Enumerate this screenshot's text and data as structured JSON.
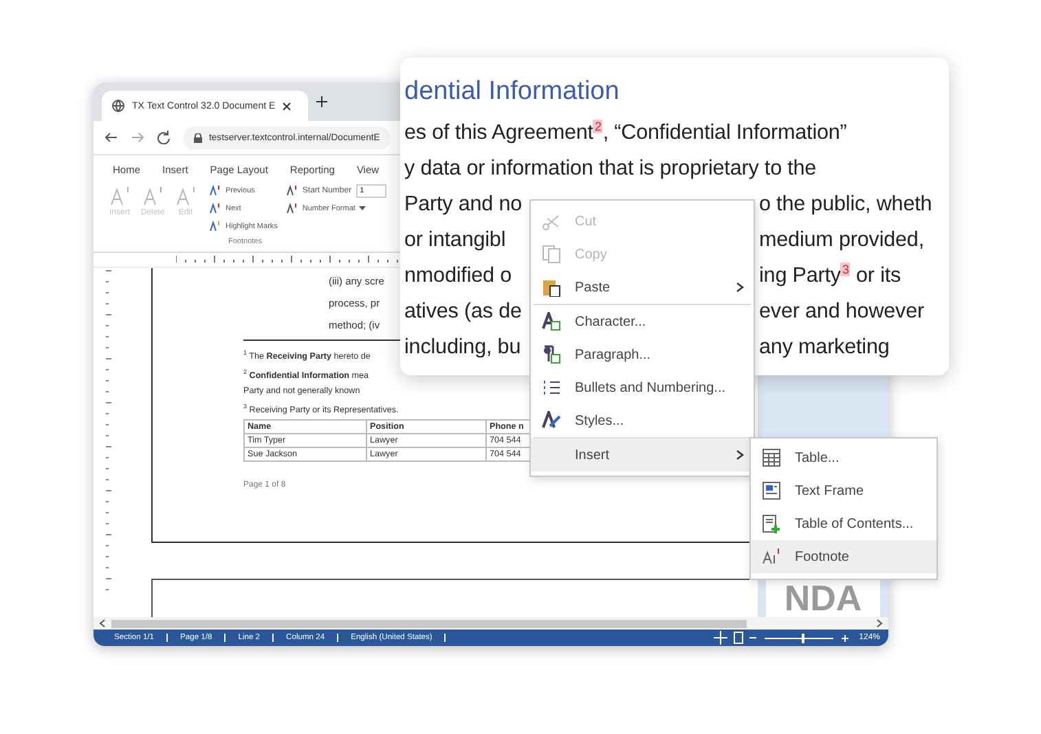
{
  "browser": {
    "tab_title": "TX Text Control 32.0 Document E",
    "url": "testserver.textcontrol.internal/DocumentE"
  },
  "ribbon": {
    "tabs": [
      "Home",
      "Insert",
      "Page Layout",
      "Reporting",
      "View"
    ],
    "large_buttons": [
      {
        "label": "Insert",
        "disabled": true
      },
      {
        "label": "Delete",
        "disabled": true
      },
      {
        "label": "Edit",
        "disabled": true
      }
    ],
    "small_buttons": [
      "Previous",
      "Next",
      "Highlight Marks"
    ],
    "start_number": {
      "label": "Start Number",
      "value": "1"
    },
    "number_format": {
      "label": "Number Format"
    },
    "group_label": "Footnotes"
  },
  "document": {
    "body_lines": [
      "(iii) any scre",
      "process, pr",
      "method; (iv"
    ],
    "footnotes": [
      "$^{1}$ The **Receiving Party** hereto de",
      "$^{2}$ **Confidential Information** mea",
      "Party and not generally known",
      "$^{3}$ Receiving Party or its Representatives."
    ],
    "table": {
      "columns": [
        "Name",
        "Position",
        "Phone n"
      ],
      "rows": [
        [
          "Tim Typer",
          "Lawyer",
          "704 544"
        ],
        [
          "Sue Jackson",
          "Lawyer",
          "704 544"
        ]
      ]
    },
    "page_footer": "Page 1 of 8"
  },
  "thumbnail": {
    "text": "NDA"
  },
  "status_bar": {
    "fields": [
      "Section 1/1",
      "Page 1/8",
      "Line 2",
      "Column 24",
      "English (United States)"
    ],
    "zoom": {
      "level": 0.55,
      "reading": "124%"
    }
  },
  "magnified": {
    "heading": "dential Information",
    "lines": [
      {
        "left": "es of this Agreement$^{2}$, “Confidential Information”"
      },
      {
        "left": "y data or information that is proprietary to the"
      },
      {
        "left": "Party and no",
        "right": "o the public, wheth"
      },
      {
        "left": "or intangibl",
        "right": "medium provided,"
      },
      {
        "left": "nmodified o",
        "right": "ing Party$^{3}$ or its"
      },
      {
        "left": "atives (as de",
        "right": "ever and however"
      },
      {
        "left": "including, bu",
        "right": "any marketing"
      }
    ]
  },
  "context_menu": {
    "items": [
      {
        "kind": "item",
        "label": "Cut",
        "disabled": true,
        "submenu": false,
        "selected": false
      },
      {
        "kind": "item",
        "label": "Copy",
        "disabled": true,
        "submenu": false,
        "selected": false
      },
      {
        "kind": "item",
        "label": "Paste",
        "disabled": false,
        "submenu": true,
        "selected": false
      },
      {
        "kind": "separator"
      },
      {
        "kind": "item",
        "label": "Character...",
        "disabled": false,
        "submenu": false,
        "selected": false
      },
      {
        "kind": "item",
        "label": "Paragraph...",
        "disabled": false,
        "submenu": false,
        "selected": false
      },
      {
        "kind": "item",
        "label": "Bullets and Numbering...",
        "disabled": false,
        "submenu": false,
        "selected": false
      },
      {
        "kind": "item",
        "label": "Styles...",
        "disabled": false,
        "submenu": false,
        "selected": false
      },
      {
        "kind": "separator"
      },
      {
        "kind": "item",
        "label": "Insert",
        "disabled": false,
        "submenu": true,
        "selected": true
      }
    ]
  },
  "submenu": {
    "items": [
      {
        "label": "Table...",
        "selected": false
      },
      {
        "label": "Text Frame",
        "selected": false
      },
      {
        "label": "Table of Contents...",
        "selected": false
      },
      {
        "label": "Footnote",
        "selected": true
      }
    ]
  }
}
